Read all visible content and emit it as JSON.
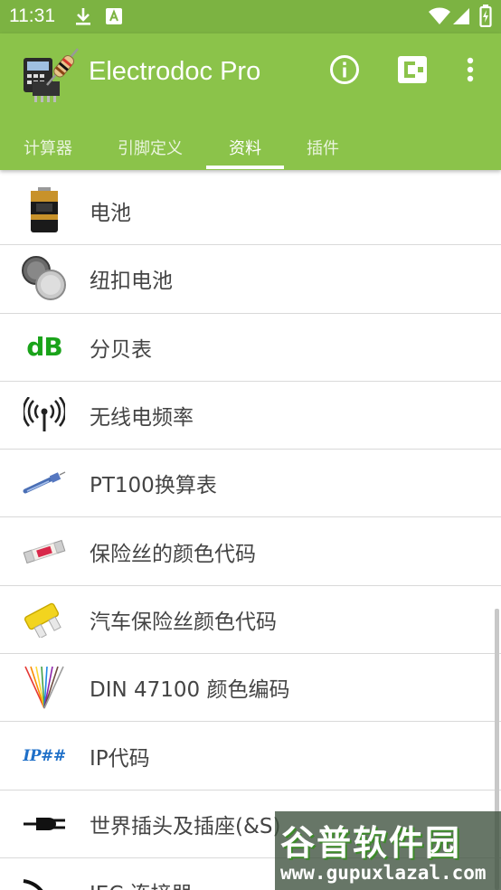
{
  "status_bar": {
    "time": "11:31",
    "icons": [
      "download-icon",
      "app-notification-icon",
      "wifi-icon",
      "cell-signal-icon",
      "battery-charging-icon"
    ]
  },
  "app_bar": {
    "title": "Electrodoc Pro",
    "logo": "electrodoc-logo",
    "actions": [
      "info-icon",
      "plugin-icon",
      "more-vert-icon"
    ],
    "color": "#8bc34a"
  },
  "tabs": [
    {
      "label": "计算器"
    },
    {
      "label": "引脚定义"
    },
    {
      "label": "资料",
      "active": true
    },
    {
      "label": "插件"
    }
  ],
  "list": {
    "items": [
      {
        "label": "电池",
        "icon": "battery-icon"
      },
      {
        "label": "纽扣电池",
        "icon": "coin-cell-icon"
      },
      {
        "label": "分贝表",
        "icon": "db-icon",
        "icon_text": "dB"
      },
      {
        "label": "无线电频率",
        "icon": "radio-wave-icon"
      },
      {
        "label": "PT100换算表",
        "icon": "pt100-sensor-icon"
      },
      {
        "label": "保险丝的颜色代码",
        "icon": "fuse-icon"
      },
      {
        "label": "汽车保险丝颜色代码",
        "icon": "car-fuse-icon"
      },
      {
        "label": "DIN 47100 颜色编码",
        "icon": "wire-colors-icon"
      },
      {
        "label": "IP代码",
        "icon": "ip-code-icon",
        "icon_text": "IP##"
      },
      {
        "label": "世界插头及插座(&S)",
        "icon": "plug-icon"
      },
      {
        "label": "IEC 连接器",
        "icon": "iec-connector-icon"
      }
    ]
  },
  "watermark": {
    "title": "谷普软件园",
    "url": "www.gupuxlazal.com"
  }
}
